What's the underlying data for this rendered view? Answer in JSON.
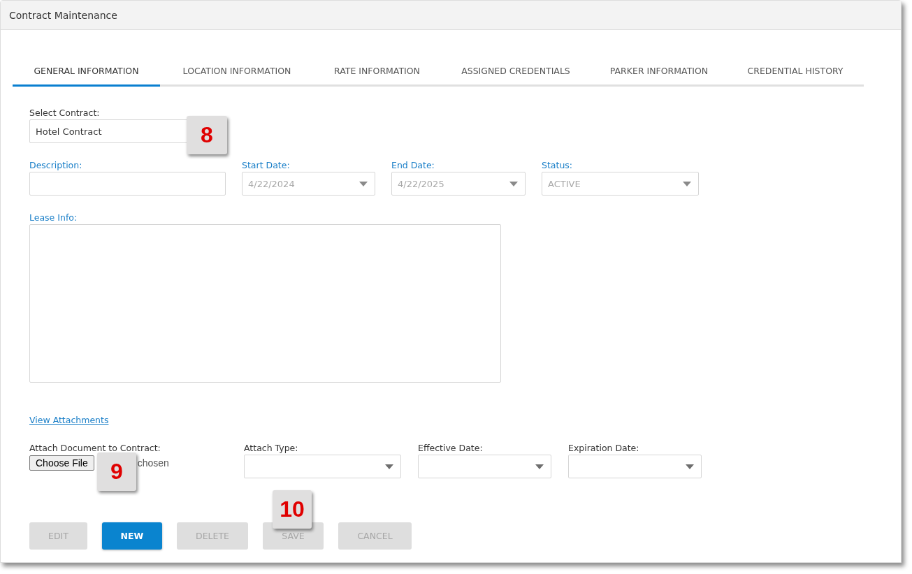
{
  "window": {
    "title": "Contract Maintenance"
  },
  "tabs": [
    {
      "label": "GENERAL INFORMATION",
      "selected": true
    },
    {
      "label": "LOCATION INFORMATION",
      "selected": false
    },
    {
      "label": "RATE INFORMATION",
      "selected": false
    },
    {
      "label": "ASSIGNED CREDENTIALS",
      "selected": false
    },
    {
      "label": "PARKER INFORMATION",
      "selected": false
    },
    {
      "label": "CREDENTIAL HISTORY",
      "selected": false
    }
  ],
  "select_contract": {
    "label": "Select Contract:",
    "value": "Hotel Contract"
  },
  "fields": [
    {
      "label": "Description:",
      "kind": "text",
      "required": true,
      "disabled": false
    },
    {
      "label": "Start Date:",
      "kind": "select",
      "required": true,
      "disabled": true,
      "value": "4/22/2024"
    },
    {
      "label": "End Date:",
      "kind": "select",
      "required": true,
      "disabled": true,
      "value": "4/22/2025"
    },
    {
      "label": "Status:",
      "kind": "select",
      "required": true,
      "disabled": true,
      "value": "ACTIVE"
    }
  ],
  "lease_info": {
    "label": "Lease Info:",
    "required": true
  },
  "view_attachments": "View Attachments",
  "attach": {
    "label": "Attach Document to Contract:",
    "button": "Choose File",
    "file_text": "chosen"
  },
  "attach_fields": [
    {
      "label": "Attach Type:",
      "kind": "select",
      "required": false
    },
    {
      "label": "Effective Date:",
      "kind": "select",
      "required": false
    },
    {
      "label": "Expiration Date:",
      "kind": "select",
      "required": false
    }
  ],
  "buttons": [
    {
      "label": "EDIT",
      "disabled": true
    },
    {
      "label": "NEW",
      "disabled": false
    },
    {
      "label": "DELETE",
      "disabled": true
    },
    {
      "label": "SAVE",
      "disabled": true
    },
    {
      "label": "CANCEL",
      "disabled": true
    }
  ],
  "callouts": [
    {
      "label": "8"
    },
    {
      "label": "9"
    },
    {
      "label": "10"
    }
  ]
}
